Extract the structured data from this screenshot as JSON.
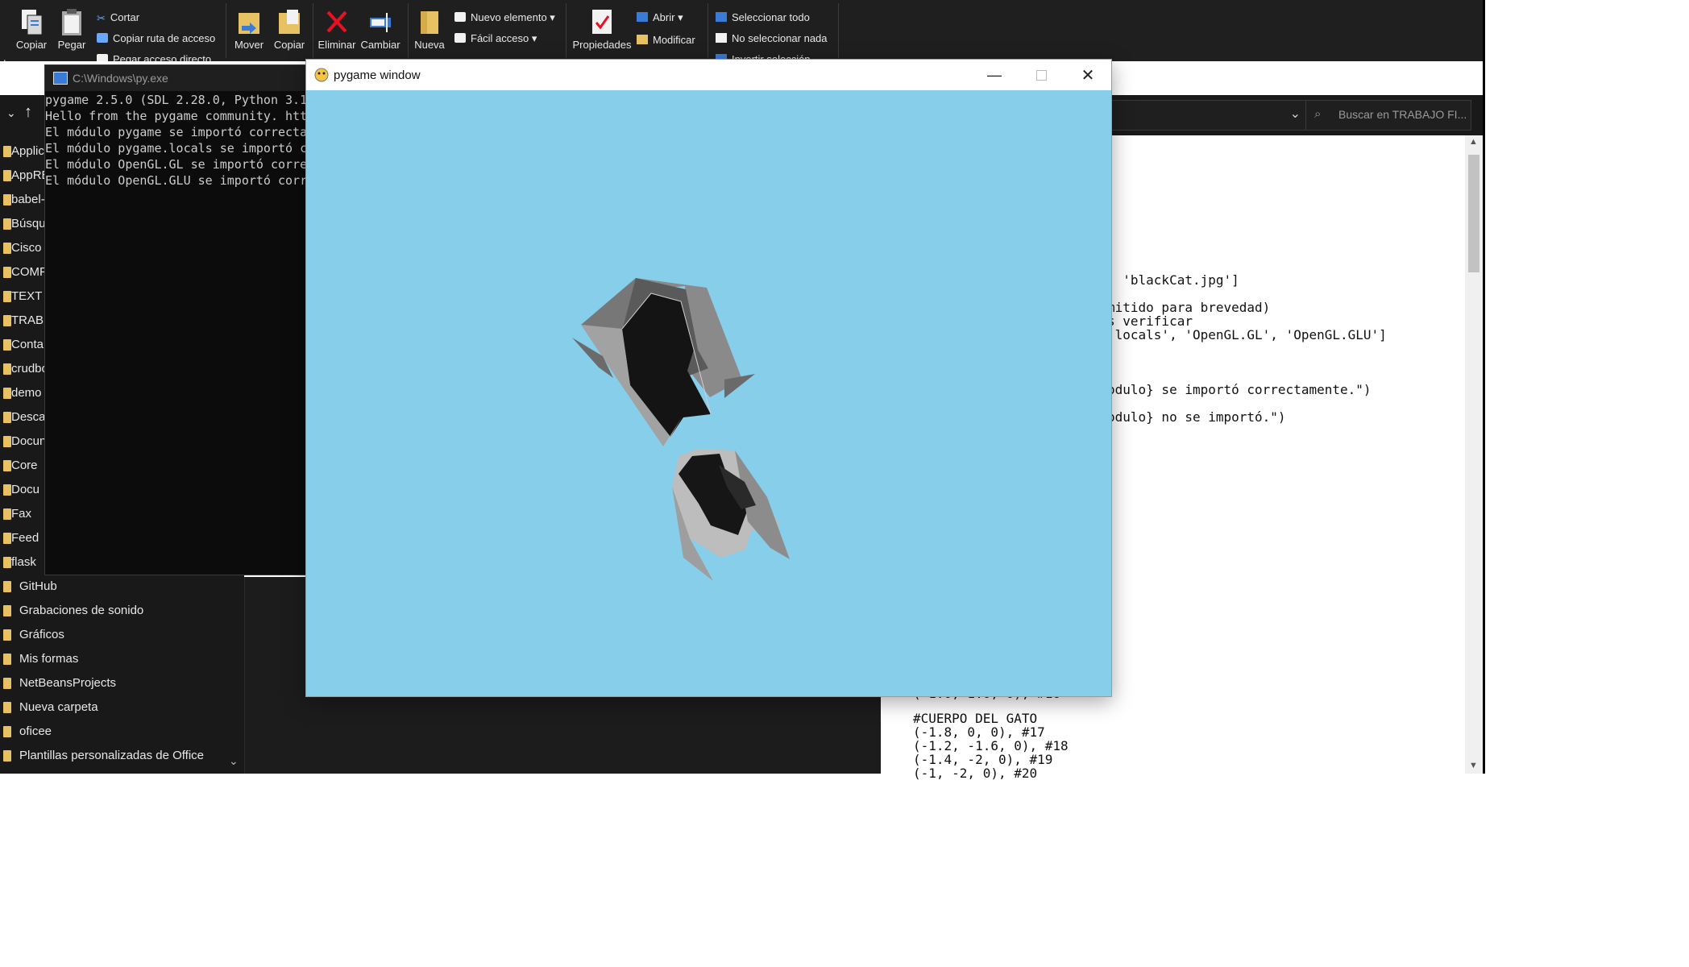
{
  "ribbon": {
    "copy_label": "Copiar",
    "paste_label": "Pegar",
    "cut_label": "Cortar",
    "copy_path_label": "Copiar ruta de acceso",
    "paste_shortcut_label": "Pegar acceso directo",
    "move_label": "Mover",
    "copy_to_label": "Copiar",
    "delete_label": "Eliminar",
    "rename_label": "Cambiar",
    "new_folder_label": "Nueva",
    "new_item_label": "Nuevo elemento",
    "easy_access_label": "Fácil acceso",
    "properties_label": "Propiedades",
    "open_label": "Abrir",
    "modify_label": "Modificar",
    "select_all_label": "Seleccionar todo",
    "select_none_label": "No seleccionar nada",
    "invert_selection_label": "Invertir selección",
    "left_partial_label": "do"
  },
  "explorer": {
    "search_placeholder": "Buscar en TRABAJO FI...",
    "sidebar": [
      "Applic",
      "AppRE",
      "babel-",
      "Búsqu",
      "Cisco l",
      "COMP",
      "TEXT",
      "TRAB",
      "Conta",
      "crudbo",
      "demo",
      "Desca",
      "Docun",
      "Core",
      "Docu",
      "Fax",
      "Feed",
      "flask",
      "GitHub",
      "Grabaciones de sonido",
      "Gráficos",
      "Mis formas",
      "NetBeansProjects",
      "Nueva carpeta",
      "oficee",
      "Plantillas personalizadas de Office"
    ]
  },
  "console": {
    "title": "C:\\Windows\\py.exe",
    "lines": [
      "pygame 2.5.0 (SDL 2.28.0, Python 3.1",
      "Hello from the pygame community. htt",
      "El módulo pygame se importó correcta",
      "El módulo pygame.locals se importó c",
      "El módulo OpenGL.GL se importó corre",
      "El módulo OpenGL.GLU se importó corr"
    ]
  },
  "editor": {
    "lines": [
      ", 'blackCat.jpg']",
      "mitido para brevedad)",
      "s verificar",
      ".locals', 'OpenGL.GL', 'OpenGL.GLU']",
      ":",
      "odulo} se importó correctamente.\")",
      "odulo} no se importó.\")",
      "(-1.0, 1.0, 0), #16",
      "#CUERPO DEL GATO",
      "(-1.8, 0, 0), #17",
      "(-1.2, -1.6, 0), #18",
      "(-1.4, -2, 0), #19",
      "(-1, -2, 0), #20"
    ]
  },
  "pygame": {
    "title": "pygame window",
    "canvas_color": "#87ceeb"
  }
}
